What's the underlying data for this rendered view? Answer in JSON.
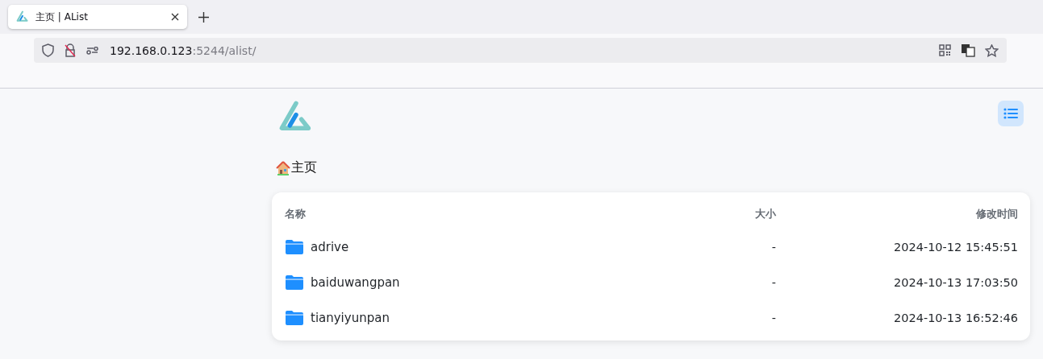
{
  "browser": {
    "tab": {
      "title": "主页 | AList",
      "selected": true
    },
    "address": {
      "host": "192.168.0.123",
      "path": ":5244/alist/"
    }
  },
  "breadcrumb": {
    "label": "主页"
  },
  "table": {
    "columns": [
      "名称",
      "大小",
      "修改时间"
    ],
    "rows": [
      {
        "name": "adrive",
        "size": "-",
        "modified": "2024-10-12 15:45:51"
      },
      {
        "name": "baiduwangpan",
        "size": "-",
        "modified": "2024-10-13 17:03:50"
      },
      {
        "name": "tianyiyunpan",
        "size": "-",
        "modified": "2024-10-13 16:52:46"
      }
    ]
  }
}
